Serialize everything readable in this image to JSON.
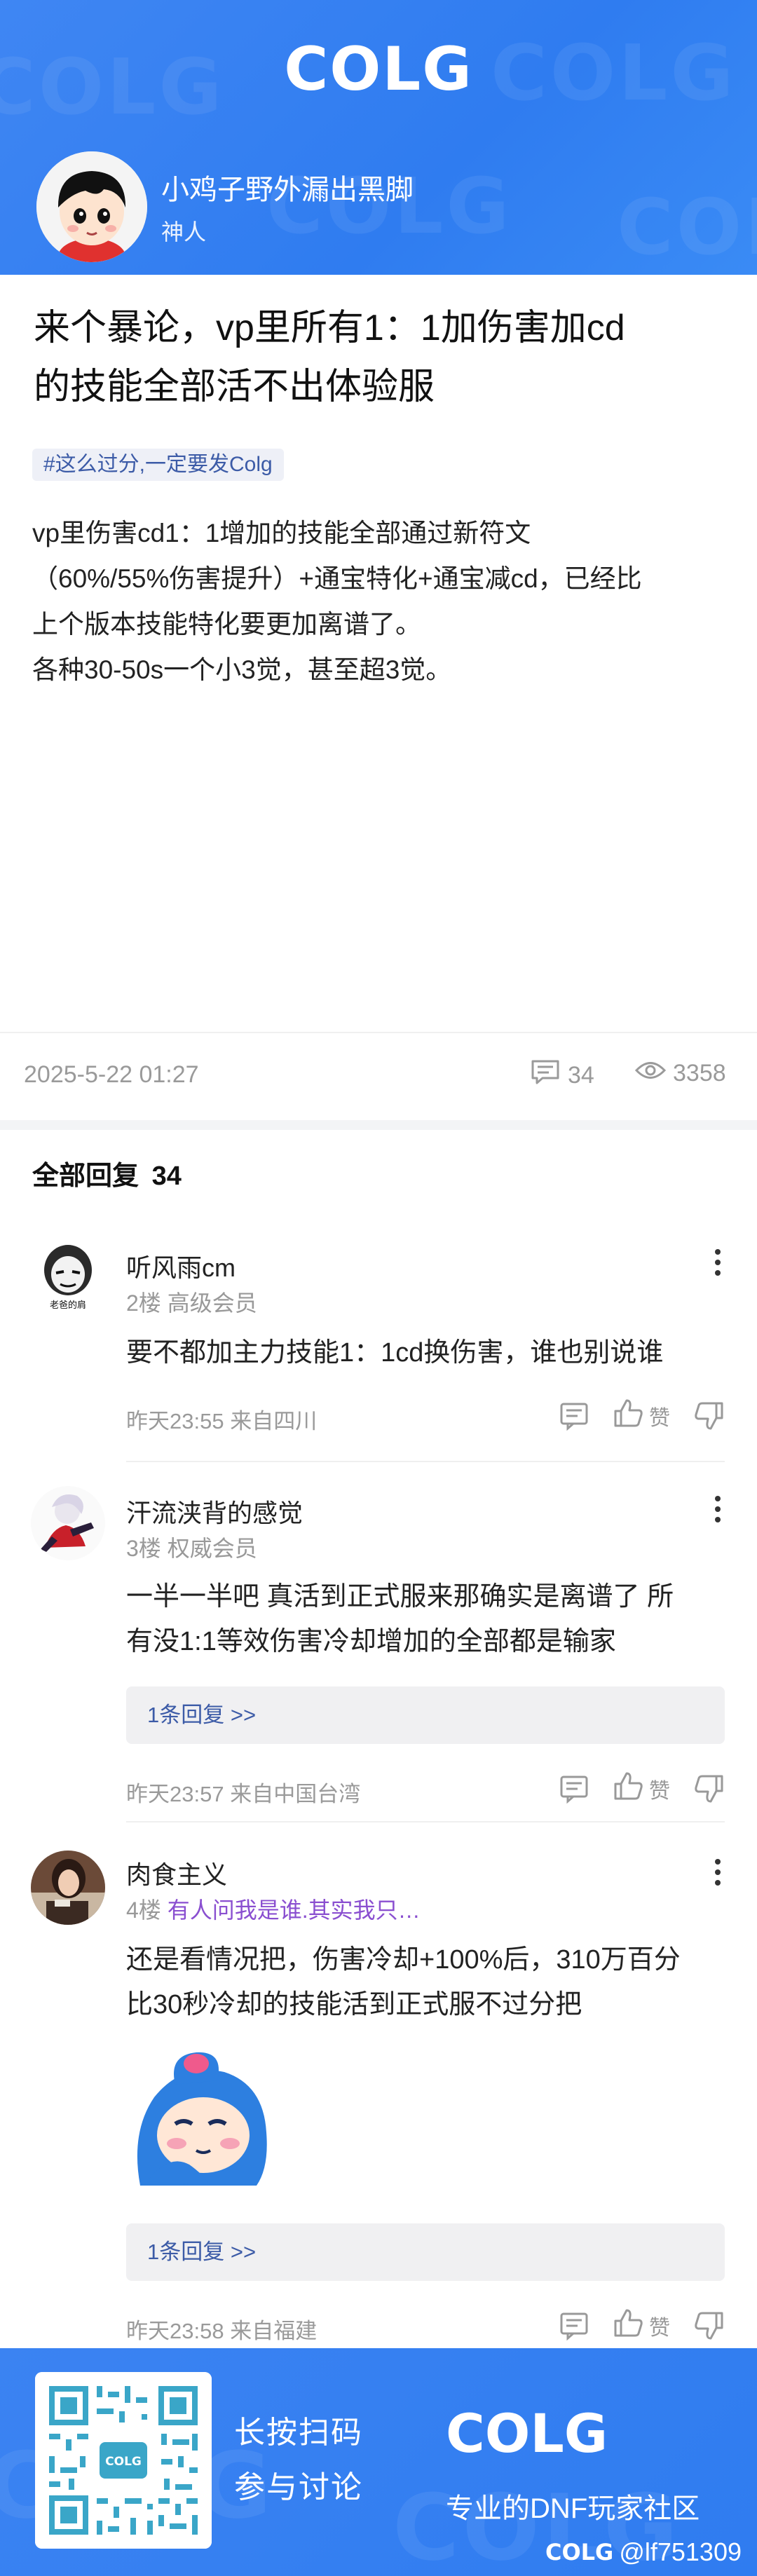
{
  "brand": {
    "logo_text": "COLG"
  },
  "author": {
    "name": "小鸡子野外漏出黑脚",
    "title": "神人"
  },
  "post": {
    "title_line1": "来个暴论，vp里所有1：1加伤害加cd",
    "title_line2": "的技能全部活不出体验服",
    "tag": "#这么过分,一定要发Colg",
    "body": [
      "vp里伤害cd1：1增加的技能全部通过新符文",
      "（60%/55%伤害提升）+通宝特化+通宝减cd，已经比",
      "上个版本技能特化要更加离谱了。",
      "各种30-50s一个小3觉，甚至超3觉。"
    ],
    "time": "2025-5-22 01:27",
    "comment_count": "34",
    "view_count": "3358"
  },
  "replies_header": {
    "label": "全部回复",
    "count": "34"
  },
  "replies": [
    {
      "name": "听风雨cm",
      "floor": "2楼",
      "rank": "高级会员",
      "text": [
        "要不都加主力技能1：1cd换伤害，谁也别说谁"
      ],
      "sub_reply": "",
      "time": "昨天23:55",
      "location": "来自四川",
      "like_label": "赞",
      "avatar_caption": "老爸的肩"
    },
    {
      "name": "汗流浃背的感觉",
      "floor": "3楼",
      "rank": "权威会员",
      "text": [
        "一半一半吧 真活到正式服来那确实是离谱了 所",
        "有没1:1等效伤害冷却增加的全部都是输家"
      ],
      "sub_reply": "1条回复 >>",
      "time": "昨天23:57",
      "location": "来自中国台湾",
      "like_label": "赞"
    },
    {
      "name": "肉食主义",
      "floor": "4楼",
      "rank": "有人问我是谁.其实我只…",
      "text": [
        "还是看情况把，伤害冷却+100%后，310万百分",
        "比30秒冷却的技能活到正式服不过分把"
      ],
      "sub_reply": "1条回复 >>",
      "time": "昨天23:58",
      "location": "来自福建",
      "like_label": "赞"
    }
  ],
  "footer": {
    "line1": "长按扫码",
    "line2": "参与讨论",
    "slogan": "专业的DNF玩家社区",
    "credit_brand": "COLG",
    "credit_user": "@lf751309",
    "qr_caption": "COLG"
  },
  "colors": {
    "brand_blue": "#2f7cf0",
    "link_blue": "#3c5ba7",
    "rank_purple": "#8a4fd0"
  },
  "icons": [
    "comment-icon",
    "eye-icon",
    "more-icon",
    "reply-icon",
    "thumb-up-icon",
    "thumb-down-icon"
  ]
}
